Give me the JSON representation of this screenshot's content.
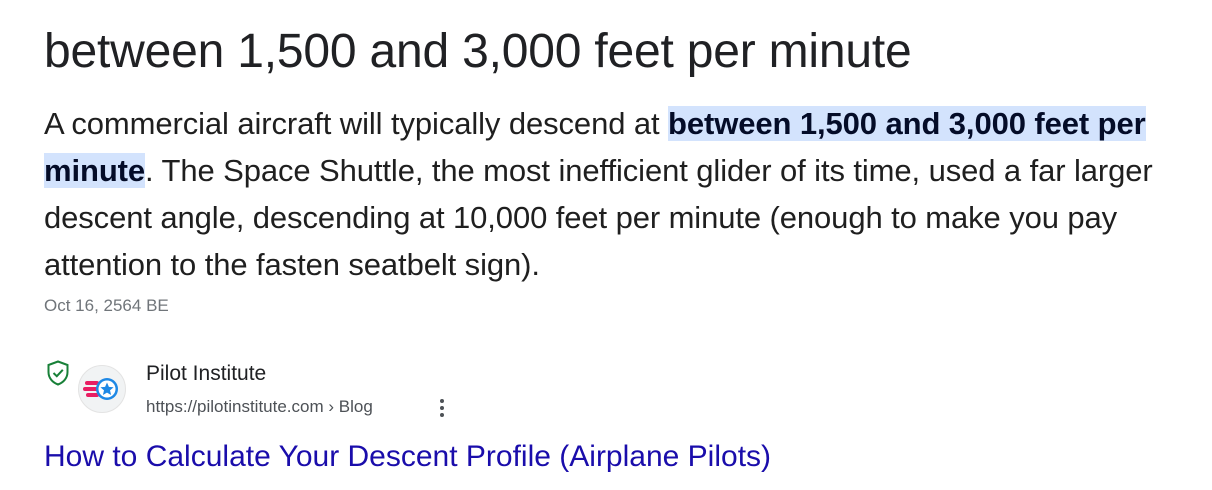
{
  "answer": {
    "title": "between 1,500 and 3,000 feet per minute"
  },
  "snippet": {
    "before": "A commercial aircraft will typically descend at ",
    "highlight": "between 1,500 and 3,000 feet per minute",
    "after": ". The Space Shuttle, the most inefficient glider of its time, used a far larger descent angle, descending at 10,000 feet per minute (enough to make you pay attention to the fasten seatbelt sign).",
    "date": "Oct 16, 2564 BE"
  },
  "source": {
    "site_name": "Pilot Institute",
    "url": "https://pilotinstitute.com › Blog",
    "link_title": "How to Calculate Your Descent Profile (Airplane Pilots)",
    "icons": [
      "verified-shield-icon",
      "pilot-institute-favicon-icon",
      "more-options-icon"
    ]
  },
  "colors": {
    "highlight_bg": "#d3e3fd",
    "link": "#1a0dab",
    "shield": "#188038",
    "favicon_pink": "#e91e63",
    "favicon_blue": "#1e88e5"
  }
}
